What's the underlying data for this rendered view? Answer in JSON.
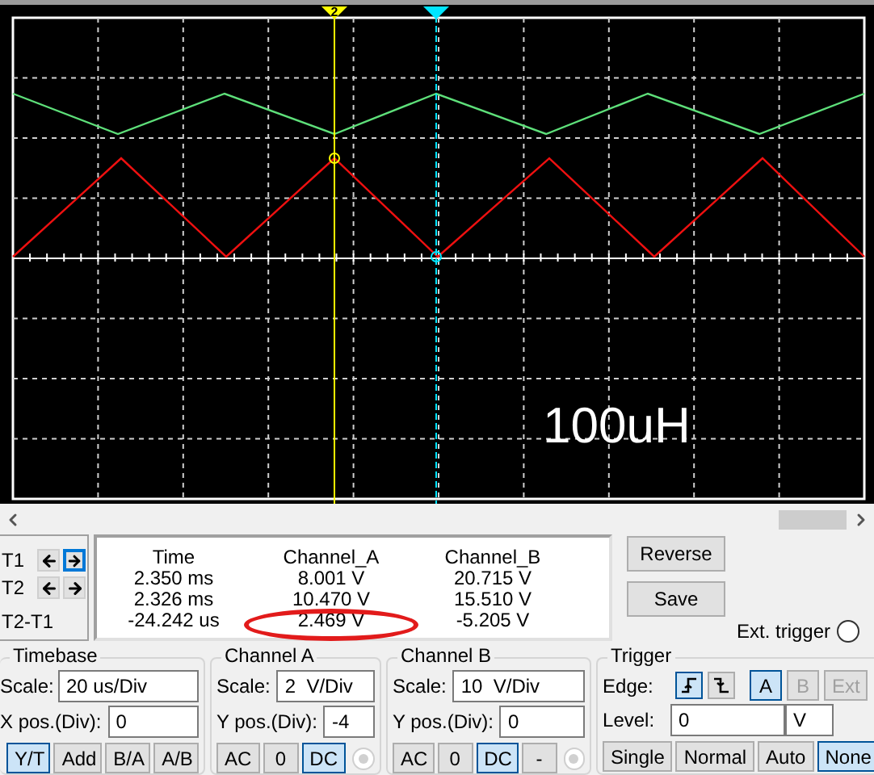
{
  "display": {
    "annotation": "100uH",
    "cursors": [
      {
        "label": "2",
        "color": "#ffff00"
      },
      {
        "color": "#00e5ff"
      }
    ]
  },
  "cursor_controls": {
    "rows": [
      {
        "label": "T1",
        "left_selected": false,
        "right_selected": true
      },
      {
        "label": "T2",
        "left_selected": false,
        "right_selected": false
      }
    ],
    "diff_label": "T2-T1"
  },
  "readout": {
    "columns": [
      "Time",
      "Channel_A",
      "Channel_B"
    ],
    "rows": [
      [
        {
          "text": "2.350 ms",
          "circled": false
        },
        {
          "text": "8.001 V",
          "circled": false
        },
        {
          "text": "20.715 V",
          "circled": false
        }
      ],
      [
        {
          "text": "2.326 ms",
          "circled": false
        },
        {
          "text": "10.470 V",
          "circled": false
        },
        {
          "text": "15.510 V",
          "circled": false
        }
      ],
      [
        {
          "text": "-24.242 us",
          "circled": false
        },
        {
          "text": "2.469 V",
          "circled": true
        },
        {
          "text": "-5.205 V",
          "circled": false
        }
      ]
    ]
  },
  "buttons": [
    "Reverse",
    "Save"
  ],
  "ext_trigger": {
    "label": "Ext. trigger",
    "selected": false
  },
  "timebase": {
    "title": "Timebase",
    "fields": [
      {
        "label": "Scale:",
        "value": "20 us/Div"
      },
      {
        "label": "X pos.(Div):",
        "value": "0"
      }
    ],
    "modes": [
      {
        "label": "Y/T",
        "selected": true
      },
      {
        "label": "Add",
        "selected": false
      },
      {
        "label": "B/A",
        "selected": false
      },
      {
        "label": "A/B",
        "selected": false
      }
    ]
  },
  "channel_a": {
    "title": "Channel A",
    "fields": [
      {
        "label": "Scale:",
        "value": "2  V/Div"
      },
      {
        "label": "Y pos.(Div):",
        "value": "-4"
      }
    ],
    "coupling": [
      {
        "label": "AC",
        "selected": false
      },
      {
        "label": "0",
        "selected": false
      },
      {
        "label": "DC",
        "selected": true
      }
    ],
    "radio_disabled": true
  },
  "channel_b": {
    "title": "Channel B",
    "fields": [
      {
        "label": "Scale:",
        "value": "10  V/Div"
      },
      {
        "label": "Y pos.(Div):",
        "value": "0"
      }
    ],
    "coupling": [
      {
        "label": "AC",
        "selected": false
      },
      {
        "label": "0",
        "selected": false
      },
      {
        "label": "DC",
        "selected": true
      },
      {
        "label": "-",
        "selected": false
      }
    ],
    "radio_disabled": true
  },
  "trigger": {
    "title": "Trigger",
    "edge_label": "Edge:",
    "edges": [
      {
        "kind": "rising",
        "selected": true
      },
      {
        "kind": "falling",
        "selected": false
      }
    ],
    "sources": [
      {
        "label": "A",
        "selected": true,
        "disabled": false
      },
      {
        "label": "B",
        "selected": false,
        "disabled": true
      },
      {
        "label": "Ext",
        "selected": false,
        "disabled": true
      }
    ],
    "level_label": "Level:",
    "level_value": "0",
    "level_unit": "V",
    "modes": [
      {
        "label": "Single",
        "selected": false
      },
      {
        "label": "Normal",
        "selected": false
      },
      {
        "label": "Auto",
        "selected": false
      },
      {
        "label": "None",
        "selected": true
      }
    ]
  }
}
